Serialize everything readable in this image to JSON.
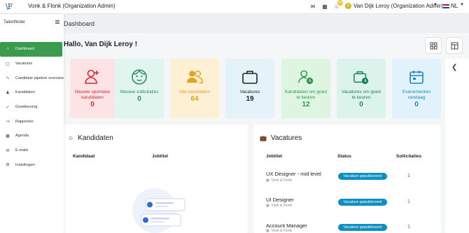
{
  "topbar": {
    "logo": "\\F",
    "org_title": "Vonk & Flonk (Organization Admin)",
    "notification_count": "10",
    "avatar_initial": "V",
    "user_name": "Van Dijk Leroy (Organization Admin)",
    "language": "NL"
  },
  "sidebar": {
    "brand": "Talentfinder",
    "items": [
      {
        "label": "Dashboard",
        "icon": "home-icon",
        "active": true
      },
      {
        "label": "Vacatures",
        "icon": "briefcase-icon"
      },
      {
        "label": "Candidate pipeline overview",
        "icon": "pipeline-icon"
      },
      {
        "label": "Kandidaten",
        "icon": "users-icon"
      },
      {
        "label": "Goedkeuring",
        "icon": "check-icon"
      },
      {
        "label": "Rapporten",
        "icon": "chart-icon"
      },
      {
        "label": "Agenda",
        "icon": "calendar-icon"
      },
      {
        "label": "E-mails",
        "icon": "mail-icon"
      },
      {
        "label": "Instellingen",
        "icon": "gear-icon"
      }
    ]
  },
  "main": {
    "title": "Dashboard",
    "greeting": "Hallo, Van Dijk Leroy !"
  },
  "cards": [
    {
      "label": "Nieuwe spontane kandidaten",
      "value": "0",
      "bg": "#fde3e3",
      "fg": "#d62b3f",
      "icon": "user-plus-icon"
    },
    {
      "label": "Nieuwe sollicitaties",
      "value": "0",
      "bg": "#dff5ee",
      "fg": "#2f8a66",
      "icon": "face-icon"
    },
    {
      "label": "Alle kandidaten",
      "value": "64",
      "bg": "#fdf0d5",
      "fg": "#e3a31a",
      "icon": "users-icon"
    },
    {
      "label": "Vacatures",
      "value": "19",
      "bg": "#e4f3f9",
      "fg": "#222222",
      "icon": "briefcase-icon"
    },
    {
      "label": "Kandidaten om goed te keuren",
      "value": "12",
      "bg": "#def5e2",
      "fg": "#2e9a47",
      "icon": "user-clock-icon"
    },
    {
      "label": "Vacatures om goed te keuren",
      "value": "0",
      "bg": "#dcf3ec",
      "fg": "#1f7f63",
      "icon": "briefcase-clock-icon"
    },
    {
      "label": "Evenementen vandaag",
      "value": "0",
      "bg": "#e1f2fa",
      "fg": "#1887c4",
      "icon": "calendar-icon"
    }
  ],
  "kandidaten": {
    "title": "Kandidaten",
    "columns": [
      "Kandidaat",
      "Jobtitel"
    ]
  },
  "vacatures": {
    "title": "Vacatures",
    "columns": [
      "Jobtitel",
      "Status",
      "Sollicitaties"
    ],
    "rows": [
      {
        "title": "UX Designer - mid level",
        "company": "Vonk & Flonk",
        "status": "Vacature gepubliceerd",
        "count": "1"
      },
      {
        "title": "UI Designer",
        "company": "Vonk & Flonk",
        "status": "Vacature gepubliceerd",
        "count": "1"
      },
      {
        "title": "Account Manager",
        "company": "Vonk & Flonk",
        "status": "Vacature gepubliceerd",
        "count": "1"
      }
    ]
  }
}
